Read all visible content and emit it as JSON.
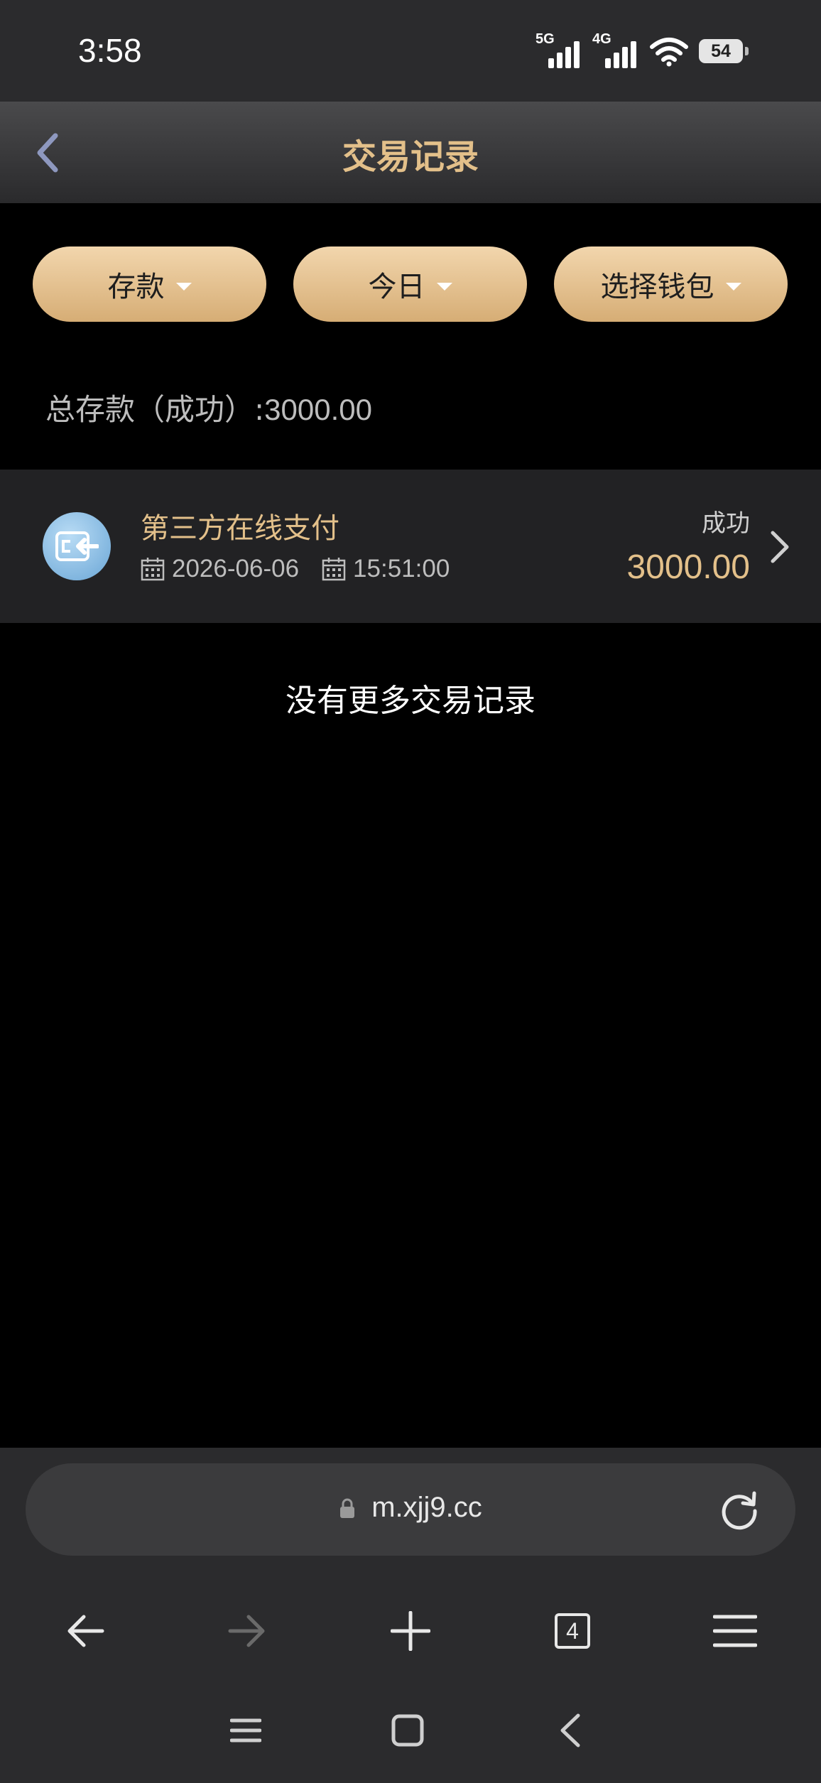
{
  "status_bar": {
    "time": "3:58",
    "signal_1": "5G",
    "signal_2": "4G",
    "battery": "54"
  },
  "header": {
    "title": "交易记录"
  },
  "filters": [
    {
      "label": "存款"
    },
    {
      "label": "今日"
    },
    {
      "label": "选择钱包"
    }
  ],
  "summary": {
    "label": "总存款（成功）",
    "separator": ":",
    "value": "3000.00"
  },
  "record": {
    "title": "第三方在线支付",
    "date": "2026-06-06",
    "time": "15:51:00",
    "status": "成功",
    "amount": "3000.00"
  },
  "empty_message": "没有更多交易记录",
  "browser": {
    "url": "m.xjj9.cc",
    "tab_count": "4"
  },
  "colors": {
    "accent_gold": "#e3c08a",
    "button_gold": "#e2bd8a",
    "record_bg": "#222224"
  }
}
